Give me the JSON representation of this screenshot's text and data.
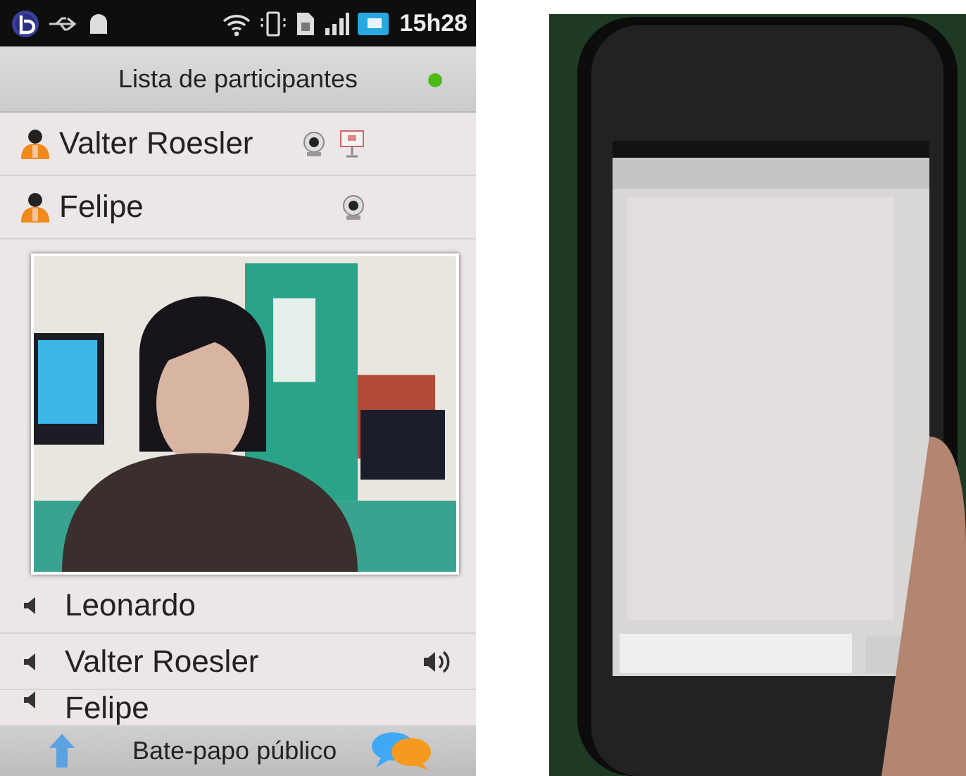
{
  "status_bar": {
    "time": "15h28"
  },
  "header": {
    "title": "Lista de participantes",
    "online": true
  },
  "participants": [
    {
      "name": "Valter Roesler",
      "webcam": true,
      "presenter": true
    },
    {
      "name": "Felipe",
      "webcam": true,
      "presenter": false
    }
  ],
  "voice": [
    {
      "name": "Leonardo",
      "talking": false
    },
    {
      "name": "Valter Roesler",
      "talking": true
    },
    {
      "name": "Felipe",
      "talking": false
    }
  ],
  "footer": {
    "title": "Bate-papo público"
  }
}
